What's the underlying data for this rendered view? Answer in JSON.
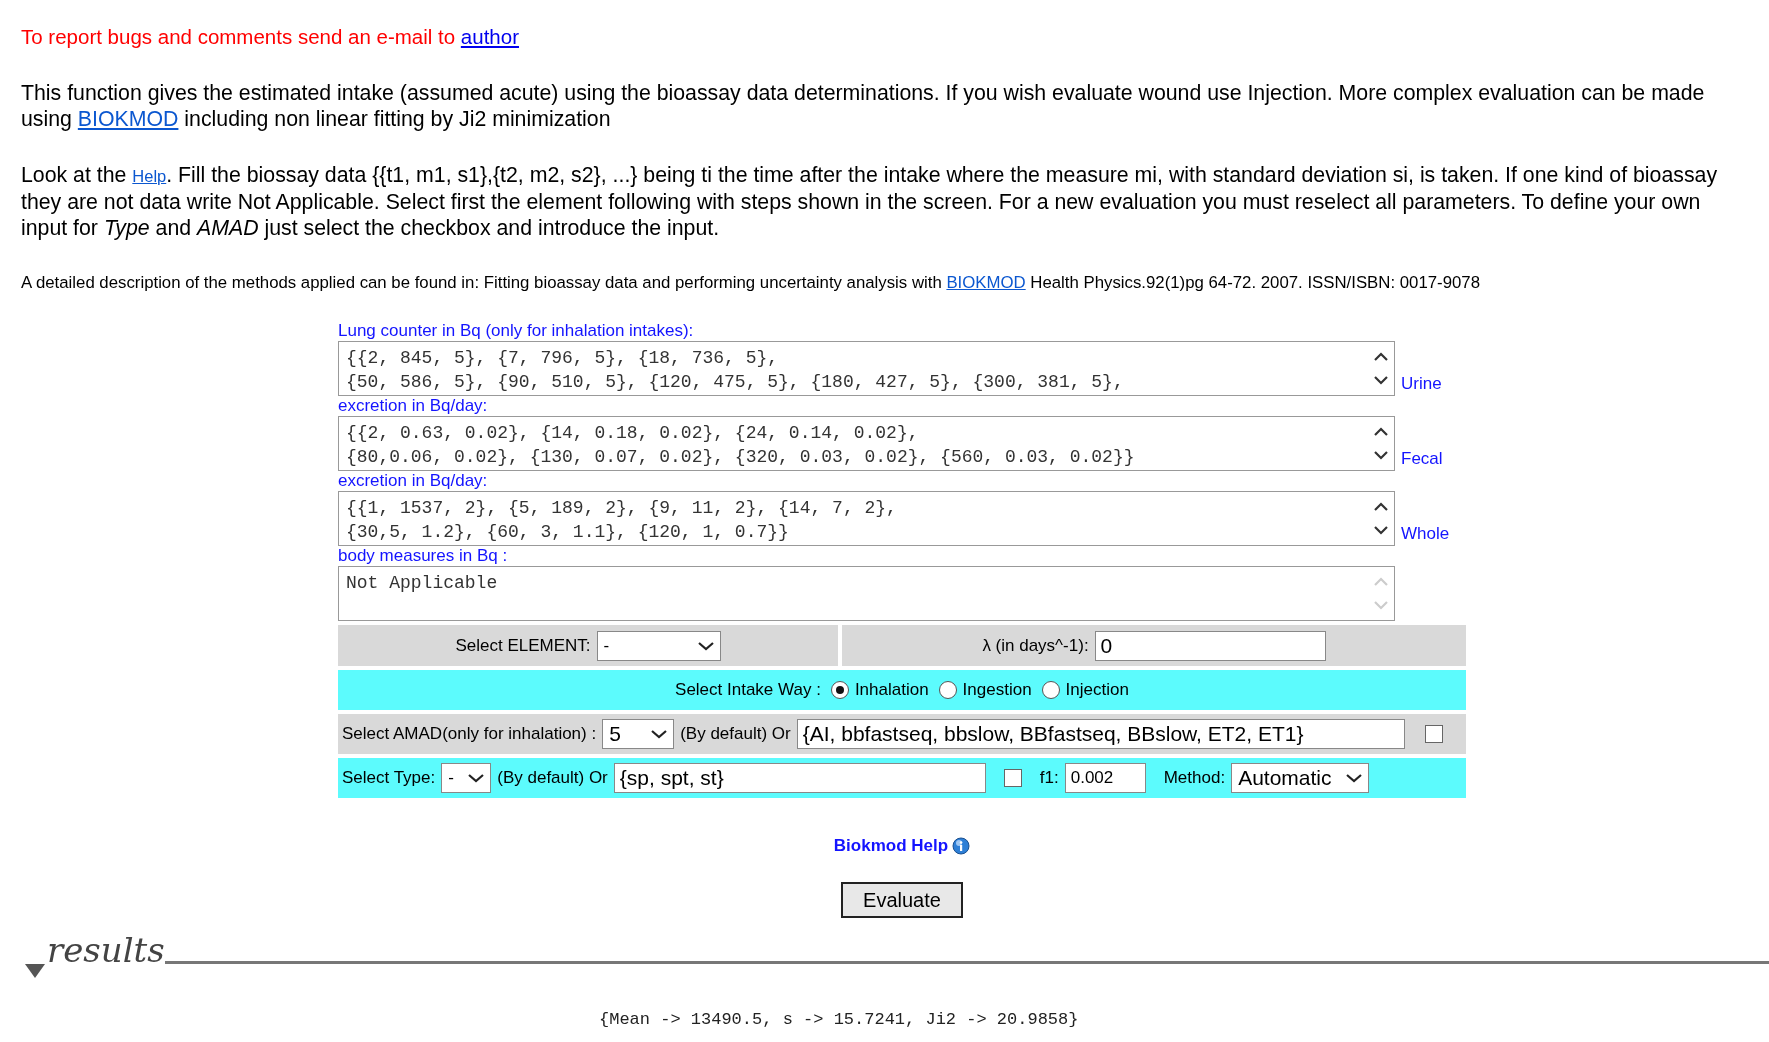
{
  "paragraphs": [
    {
      "kind": "notice",
      "segments": [
        {
          "kind": "text",
          "text": "To report bugs and comments send an e-mail to "
        },
        {
          "kind": "link",
          "text": "author"
        }
      ]
    },
    {
      "kind": "body",
      "segments": [
        {
          "kind": "text",
          "text": "This function gives the estimated intake (assumed acute) using the bioassay data determinations. If you wish evaluate wound use Injection. More complex evaluation can be made using "
        },
        {
          "kind": "link",
          "text": "BIOKMOD"
        },
        {
          "kind": "text",
          "text": " including non linear fitting by Ji2 minimization"
        }
      ]
    },
    {
      "kind": "body",
      "segments": [
        {
          "kind": "text",
          "text": "Look at the "
        },
        {
          "kind": "small-link",
          "text": "Help"
        },
        {
          "kind": "text",
          "text": ". Fill the biossay data {{t1, m1, s1},{t2, m2, s2}, ...} being ti the time after the intake where the measure mi, with standard deviation si, is taken. If one kind of bioassay they are not data write Not Applicable. Select first the element following with steps shown in the screen. For a new evaluation you must reselect all parameters. To define your own input for *Type* and *AMAD* just select the checkbox and introduce the input."
        }
      ]
    },
    {
      "kind": "small",
      "segments": [
        {
          "kind": "text",
          "text": "A detailed description of the methods applied can be found in: Fitting bioassay data and performing uncertainty analysis with "
        },
        {
          "kind": "link",
          "text": "BIOKMOD"
        },
        {
          "kind": "text",
          "text": " Health Physics.92(1)pg 64-72. 2007. ISSN/ISBN: 0017-9078"
        }
      ]
    }
  ],
  "bioassay": [
    {
      "heading": "Lung counter in Bq (only for inhalation intakes):",
      "lines": [
        "{{2, 845, 5}, {7, 796, 5}, {18, 736, 5},",
        "{50, 586, 5}, {90, 510, 5}, {120, 475, 5}, {180, 427, 5}, {300, 381, 5},"
      ],
      "side_label": "Urine",
      "scrollable": true
    },
    {
      "heading": "excretion in Bq/day:",
      "lines": [
        "{{2, 0.63, 0.02}, {14, 0.18, 0.02}, {24, 0.14, 0.02},",
        "{80,0.06, 0.02}, {130, 0.07, 0.02}, {320, 0.03, 0.02}, {560, 0.03, 0.02}}"
      ],
      "side_label": "Fecal",
      "scrollable": true
    },
    {
      "heading": "excretion in Bq/day:",
      "lines": [
        "{{1, 1537, 2}, {5, 189, 2}, {9, 11, 2}, {14, 7, 2},",
        "{30,5, 1.2}, {60, 3, 1.1}, {120, 1, 0.7}}"
      ],
      "side_label": "Whole",
      "scrollable": true
    },
    {
      "heading": "body measures in Bq :",
      "lines": [
        "Not Applicable"
      ],
      "scrollable": false
    }
  ],
  "form": {
    "element": {
      "label": "Select ELEMENT:",
      "value": "-"
    },
    "lambda": {
      "label": "λ (in days^-1):",
      "value": "0"
    },
    "intake": {
      "label": "Select Intake Way :",
      "options": [
        {
          "label": "Inhalation",
          "selected": true
        },
        {
          "label": "Ingestion",
          "selected": false
        },
        {
          "label": "Injection",
          "selected": false
        }
      ]
    },
    "amad": {
      "label": "Select AMAD(only for inhalation) :",
      "value": "5",
      "default_text": "(By default) Or",
      "custom_value": "{AI, bbfastseq, bbslow,  BBfastseq, BBslow, ET2, ET1}",
      "checked": false
    },
    "type": {
      "label": "Select Type:",
      "value": "-",
      "default_text": "(By default) Or",
      "custom_value": "{sp, spt, st}",
      "checked": false,
      "f1_label": "f1:",
      "f1_value": "0.002",
      "method_label": "Method:",
      "method_value": "Automatic"
    }
  },
  "help_link": "Biokmod Help",
  "evaluate_button": "Evaluate",
  "results": {
    "heading": "results",
    "text": "{Mean -> 13490.5, s -> 15.7241, Ji2 -> 20.9858}"
  }
}
